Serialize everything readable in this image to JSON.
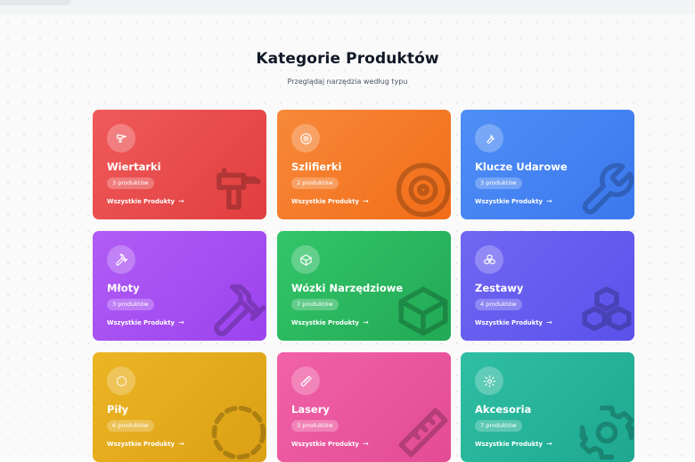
{
  "header": {
    "title": "Kategorie Produktów",
    "subtitle": "Przeglądaj narzędzia według typu"
  },
  "colors": {
    "text_dark": "#111827",
    "wiertarki": "#ea4b4b",
    "szlifierki": "#f47b28",
    "klucze": "#4683f2",
    "mloty": "#a64ff1",
    "wozki": "#2bb75f",
    "zestawy": "#665cef",
    "pily": "#e3aa1c",
    "lasery": "#ea579e",
    "akcesoria": "#27b49a"
  },
  "categories": [
    {
      "name": "Wiertarki",
      "count": "3 produktów",
      "link": "Wszystkie Produkty",
      "icon": "drill-icon"
    },
    {
      "name": "Szlifierki",
      "count": "2 produktów",
      "link": "Wszystkie Produkty",
      "icon": "disc-icon"
    },
    {
      "name": "Klucze Udarowe",
      "count": "3 produktów",
      "link": "Wszystkie Produkty",
      "icon": "wrench-icon"
    },
    {
      "name": "Młoty",
      "count": "3 produktów",
      "link": "Wszystkie Produkty",
      "icon": "hammer-icon"
    },
    {
      "name": "Wózki Narzędziowe",
      "count": "7 produktów",
      "link": "Wszystkie Produkty",
      "icon": "box-icon"
    },
    {
      "name": "Zestawy",
      "count": "4 produktów",
      "link": "Wszystkie Produkty",
      "icon": "boxes-icon"
    },
    {
      "name": "Piły",
      "count": "6 produktów",
      "link": "Wszystkie Produkty",
      "icon": "saw-circle-icon"
    },
    {
      "name": "Lasery",
      "count": "3 produktów",
      "link": "Wszystkie Produkty",
      "icon": "ruler-icon"
    },
    {
      "name": "Akcesoria",
      "count": "7 produktów",
      "link": "Wszystkie Produkty",
      "icon": "gear-icon"
    }
  ]
}
